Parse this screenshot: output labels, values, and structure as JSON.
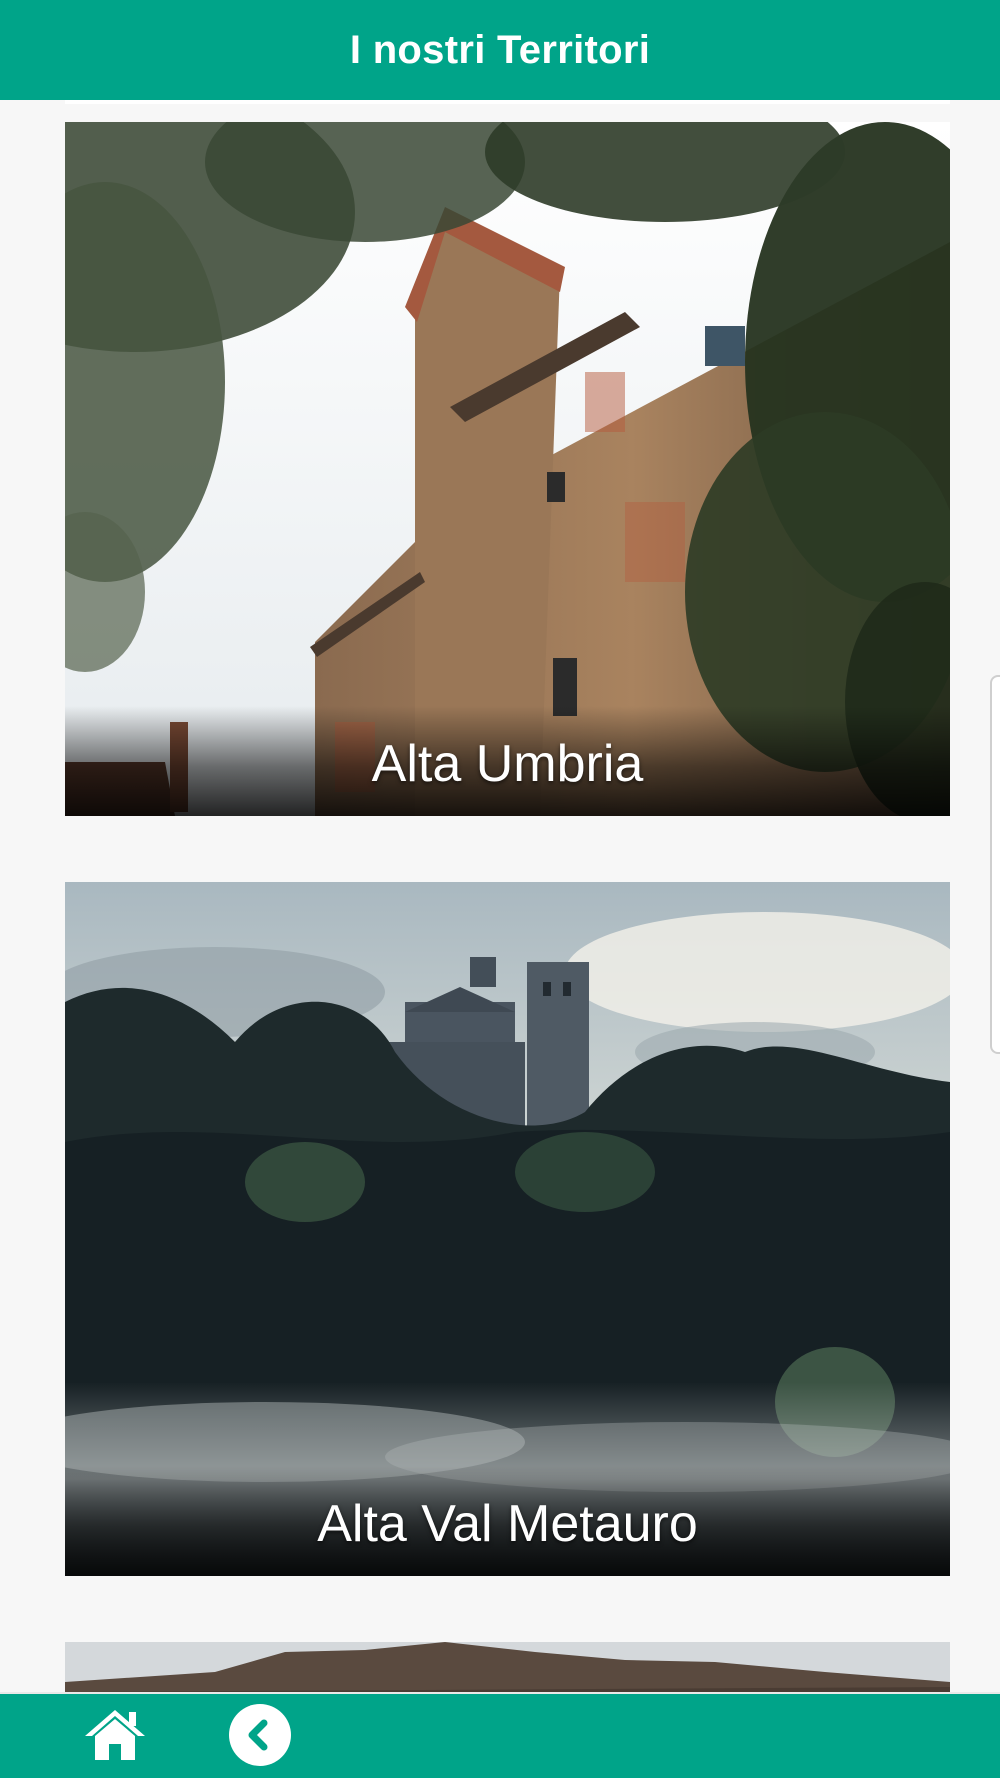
{
  "header": {
    "title": "I nostri Territori"
  },
  "territories": [
    {
      "label": "Alta Umbria"
    },
    {
      "label": "Alta Val Metauro"
    }
  ],
  "footer": {
    "home_icon": "home-icon",
    "back_icon": "chevron-left-circle-icon"
  },
  "colors": {
    "brand": "#00a489",
    "background": "#f7f7f7",
    "label_text": "#ffffff"
  }
}
